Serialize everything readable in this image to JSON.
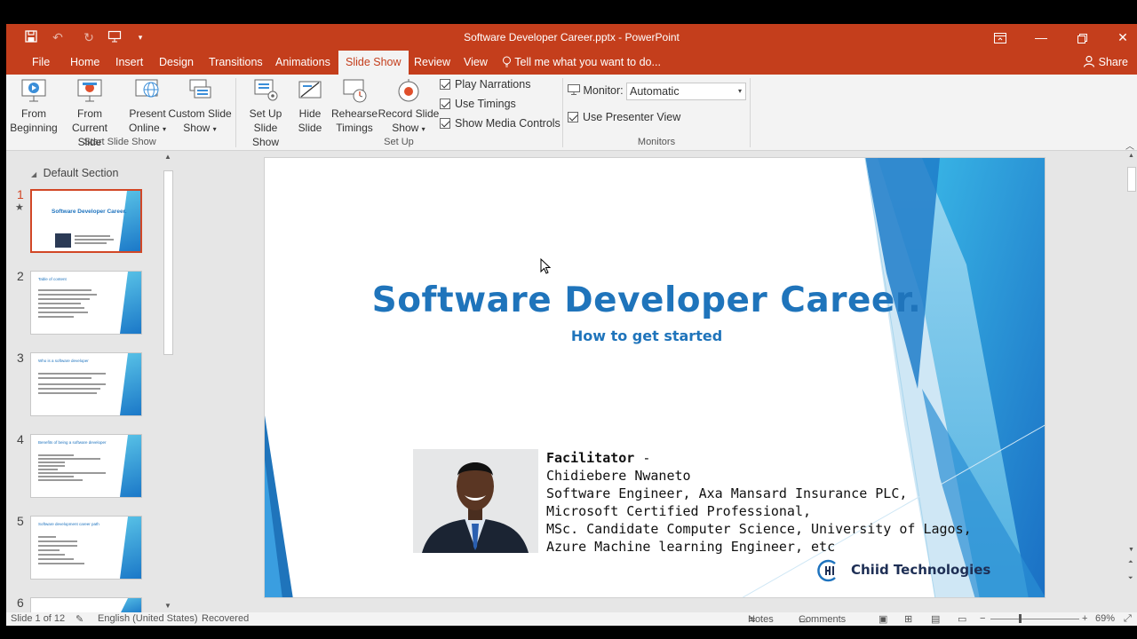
{
  "window": {
    "title": "Software Developer Career.pptx - PowerPoint"
  },
  "tabs": [
    {
      "label": "File"
    },
    {
      "label": "Home"
    },
    {
      "label": "Insert"
    },
    {
      "label": "Design"
    },
    {
      "label": "Transitions"
    },
    {
      "label": "Animations"
    },
    {
      "label": "Slide Show",
      "active": true
    },
    {
      "label": "Review"
    },
    {
      "label": "View"
    }
  ],
  "tell_me": "Tell me what you want to do...",
  "share": "Share",
  "ribbon": {
    "start_group": {
      "label": "Start Slide Show",
      "from_beginning": [
        "From",
        "Beginning"
      ],
      "from_current": [
        "From",
        "Current Slide"
      ],
      "present_online": [
        "Present",
        "Online"
      ],
      "custom_show": [
        "Custom Slide",
        "Show"
      ]
    },
    "setup_group": {
      "label": "Set Up",
      "setup_show": [
        "Set Up",
        "Slide Show"
      ],
      "hide_slide": [
        "Hide",
        "Slide"
      ],
      "rehearse": [
        "Rehearse",
        "Timings"
      ],
      "record": [
        "Record Slide",
        "Show"
      ],
      "play_narrations": "Play Narrations",
      "use_timings": "Use Timings",
      "show_media": "Show Media Controls"
    },
    "monitors_group": {
      "label": "Monitors",
      "monitor_label": "Monitor:",
      "monitor_value": "Automatic",
      "presenter_view": "Use Presenter View"
    }
  },
  "thumbnails": {
    "section": "Default Section",
    "items": [
      {
        "num": "1",
        "title": "Software Developer Career."
      },
      {
        "num": "2",
        "title": "Table of content"
      },
      {
        "num": "3",
        "title": "Who is a software developer"
      },
      {
        "num": "4",
        "title": "Benefits of being a software developer"
      },
      {
        "num": "5",
        "title": "Software development career path"
      },
      {
        "num": "6",
        "title": ""
      }
    ]
  },
  "slide": {
    "title": "Software Developer Career.",
    "subtitle": "How to get started",
    "facilitator_heading": "Facilitator",
    "facilitator_dash": " -",
    "lines": [
      "Chidiebere Nwaneto",
      "Software Engineer, Axa Mansard Insurance PLC,",
      "Microsoft Certified Professional,",
      "MSc. Candidate Computer Science, University of Lagos,",
      "Azure Machine learning Engineer, etc"
    ],
    "brand": "Chiid Technologies"
  },
  "status": {
    "slide_count": "Slide 1 of 12",
    "language": "English (United States)",
    "recovered": "Recovered",
    "notes": "Notes",
    "comments": "Comments",
    "zoom": "69%"
  },
  "colors": {
    "accent": "#c43e1c",
    "slide_title": "#1f74bb",
    "thumb_selected": "#d24726"
  }
}
